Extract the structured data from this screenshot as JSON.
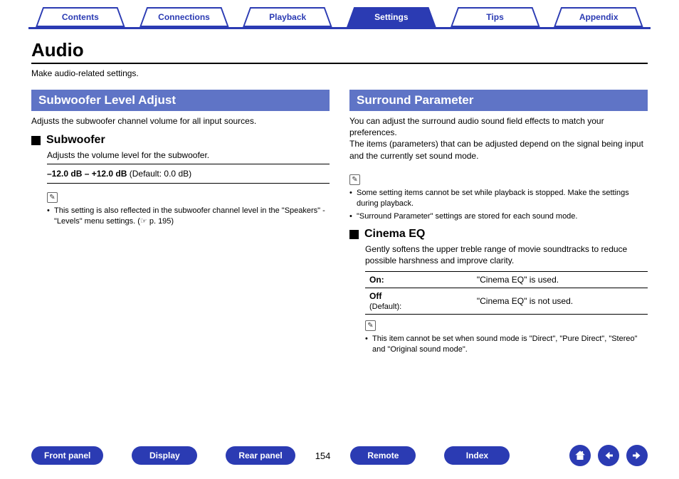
{
  "tabs": {
    "items": [
      {
        "label": "Contents",
        "active": false
      },
      {
        "label": "Connections",
        "active": false
      },
      {
        "label": "Playback",
        "active": false
      },
      {
        "label": "Settings",
        "active": true
      },
      {
        "label": "Tips",
        "active": false
      },
      {
        "label": "Appendix",
        "active": false
      }
    ]
  },
  "page_title": "Audio",
  "page_intro": "Make audio-related settings.",
  "left": {
    "section_title": "Subwoofer Level Adjust",
    "section_desc": "Adjusts the subwoofer channel volume for all input sources.",
    "sub1": {
      "title": "Subwoofer",
      "desc": "Adjusts the volume level for the subwoofer.",
      "range_bold": "–12.0 dB – +12.0 dB",
      "range_rest": " (Default: 0.0 dB)",
      "note1": "This setting is also reflected in the subwoofer channel level in the \"Speakers\" - \"Levels\" menu settings. (☞ p. 195)"
    }
  },
  "right": {
    "section_title": "Surround Parameter",
    "section_desc": "You can adjust the surround audio sound field effects to match your preferences.\nThe items (parameters) that can be adjusted depend on the signal being input and the currently set sound mode.",
    "notesA": [
      "Some setting items cannot be set while playback is stopped. Make the settings during playback.",
      "\"Surround Parameter\" settings are stored for each sound mode."
    ],
    "sub1": {
      "title": "Cinema EQ",
      "desc": "Gently softens the upper treble range of movie soundtracks to reduce possible harshness and improve clarity.",
      "rows": [
        {
          "label": "On:",
          "sub": "",
          "value": "\"Cinema EQ\" is used."
        },
        {
          "label": "Off",
          "sub": "(Default):",
          "value": "\"Cinema EQ\" is not used."
        }
      ],
      "note1": "This item cannot be set when sound mode is \"Direct\", \"Pure Direct\", \"Stereo\" and \"Original sound mode\"."
    }
  },
  "bottom": {
    "buttons": [
      "Front panel",
      "Display",
      "Rear panel"
    ],
    "page": "154",
    "buttons2": [
      "Remote",
      "Index"
    ]
  }
}
